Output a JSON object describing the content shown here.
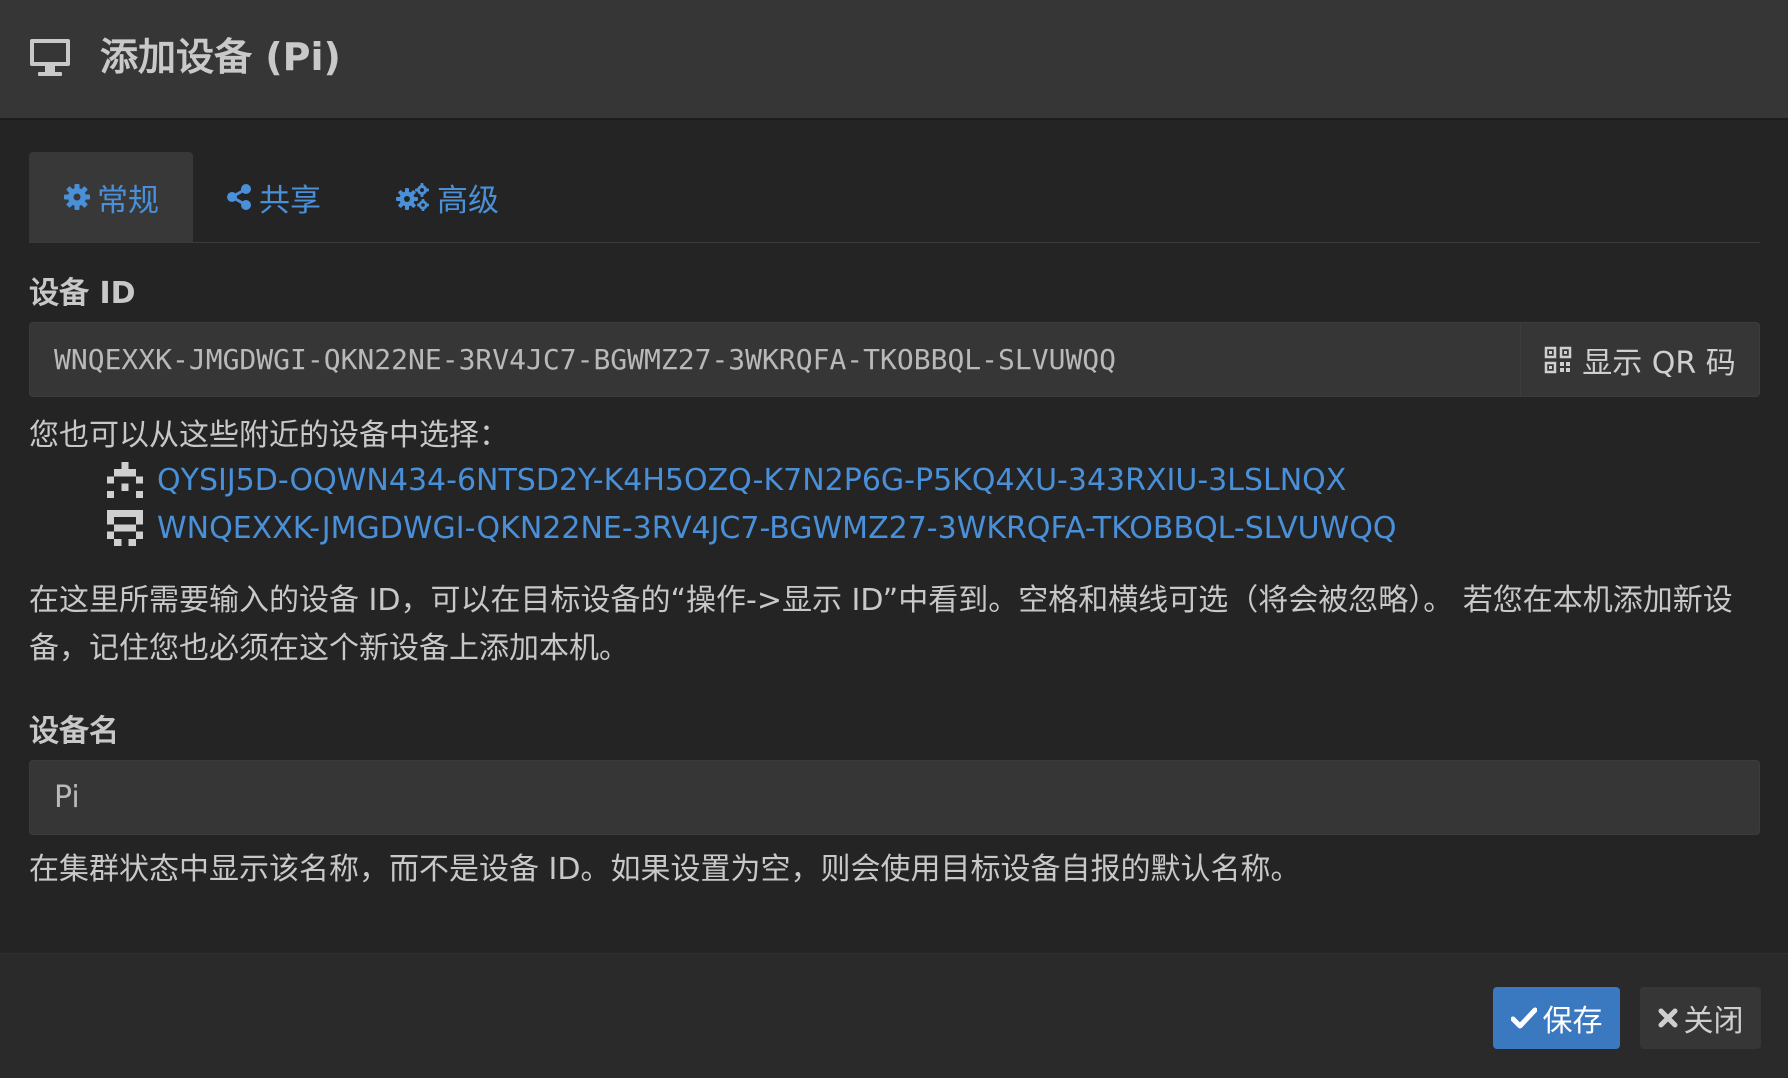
{
  "header": {
    "title": "添加设备 (Pi)",
    "icon": "desktop-icon"
  },
  "tabs": [
    {
      "label": "常规",
      "icon": "gear-icon",
      "active": true
    },
    {
      "label": "共享",
      "icon": "share-icon",
      "active": false
    },
    {
      "label": "高级",
      "icon": "gears-icon",
      "active": false
    }
  ],
  "device_id": {
    "label": "设备 ID",
    "value": "WNQEXXK-JMGDWGI-QKN22NE-3RV4JC7-BGWMZ27-3WKRQFA-TKOBBQL-SLVUWQQ",
    "qr_button_label": "显示 QR 码"
  },
  "nearby": {
    "hint": "您也可以从这些附近的设备中选择：",
    "devices": [
      "QYSIJ5D-OQWN434-6NTSD2Y-K4H5OZQ-K7N2P6G-P5KQ4XU-343RXIU-3LSLNQX",
      "WNQEXXK-JMGDWGI-QKN22NE-3RV4JC7-BGWMZ27-3WKRQFA-TKOBBQL-SLVUWQQ"
    ]
  },
  "id_help": "在这里所需要输入的设备 ID，可以在目标设备的“操作->显示 ID”中看到。空格和横线可选（将会被忽略）。 若您在本机添加新设备，记住您也必须在这个新设备上添加本机。",
  "device_name": {
    "label": "设备名",
    "value": "Pi",
    "help": "在集群状态中显示该名称，而不是设备 ID。如果设置为空，则会使用目标设备自报的默认名称。"
  },
  "footer": {
    "save_label": "保存",
    "close_label": "关闭"
  },
  "colors": {
    "accent": "#4a90d9",
    "save_bg": "#3a78c0",
    "background": "#242424",
    "header_bg": "#363636"
  }
}
